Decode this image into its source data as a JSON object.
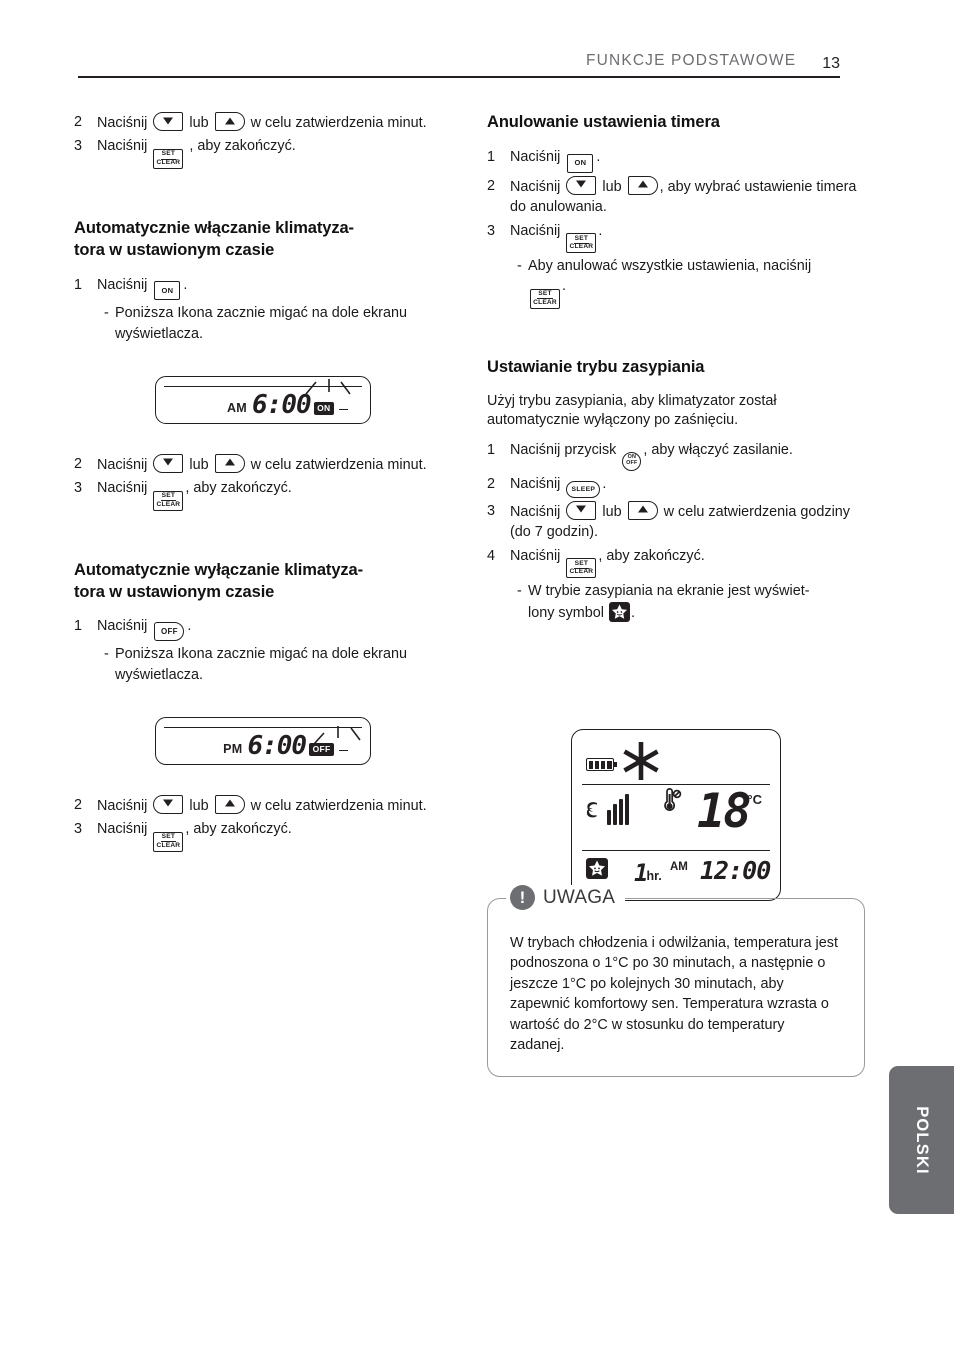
{
  "header": {
    "title": "FUNKCJE PODSTAWOWE",
    "page_number": "13"
  },
  "left_column": {
    "continued_steps": [
      {
        "num": "2",
        "text_before": "Naciśnij",
        "button": "down-up",
        "text_after": "w celu zatwierdzenia minut."
      },
      {
        "num": "3",
        "text_before": "Naciśnij",
        "button": "set-clear",
        "text_after": ", aby zakończyć."
      }
    ],
    "section_auto_on": {
      "heading": "Automatycznie włączanie klimatyza-\ntora w ustawionym czasie",
      "step1_num": "1",
      "step1_before": "Naciśnij",
      "step1_after": ".",
      "step1_button": "ON",
      "note_dash": "-",
      "note_text": "Poniższa Ikona zacznie migać na dole ekranu wyświetlacza.",
      "lcd": {
        "ampm": "AM",
        "time": "6:00",
        "badge": "ON"
      },
      "step2_num": "2",
      "step2_before": "Naciśnij",
      "step2_mid": "lub",
      "step2_after": "w celu zatwierdzenia minut.",
      "step3_num": "3",
      "step3_before": "Naciśnij",
      "step3_after": ", aby zakończyć."
    },
    "section_auto_off": {
      "heading": "Automatycznie wyłączanie klimatyza-\ntora w ustawionym czasie",
      "step1_num": "1",
      "step1_before": "Naciśnij",
      "step1_after": ".",
      "step1_button": "OFF",
      "note_dash": "-",
      "note_text": "Poniższa Ikona zacznie migać na dole ekranu wyświetlacza.",
      "lcd": {
        "ampm": "PM",
        "time": "6:00",
        "badge": "OFF"
      },
      "step2_num": "2",
      "step2_before": "Naciśnij",
      "step2_mid": "lub",
      "step2_after": "w celu zatwierdzenia minut.",
      "step3_num": "3",
      "step3_before": "Naciśnij",
      "step3_after": ", aby zakończyć."
    }
  },
  "right_column": {
    "section_cancel": {
      "heading": "Anulowanie ustawienia timera",
      "step1_num": "1",
      "step1_before": "Naciśnij",
      "step1_after": ".",
      "step1_button": "ON",
      "step2_num": "2",
      "step2_before": "Naciśnij",
      "step2_mid": "lub",
      "step2_after": ", aby wybrać ustawienie timera do anulowania.",
      "step3_num": "3",
      "step3_before": "Naciśnij",
      "step3_after": ".",
      "note_dash": "-",
      "note_text": "Aby anulować wszystkie ustawienia, naciśnij",
      "note_after": "."
    },
    "section_sleep": {
      "heading": "Ustawianie trybu zasypiania",
      "intro": "Użyj trybu zasypiania, aby klimatyzator został automatycznie wyłączony po zaśnięciu.",
      "step1_num": "1",
      "step1_before": "Naciśnij przycisk",
      "step1_after": ", aby włączyć zasilanie.",
      "step2_num": "2",
      "step2_before": "Naciśnij",
      "step2_button": "SLEEP",
      "step2_after": ".",
      "step3_num": "3",
      "step3_before": "Naciśnij",
      "step3_mid": "lub",
      "step3_after": "w celu zatwierdzenia godziny (do 7 godzin).",
      "step4_num": "4",
      "step4_before": "Naciśnij",
      "step4_after": ", aby zakończyć.",
      "note_dash": "-",
      "note_text_1": "W trybie zasypiania na ekranie jest wyświet-",
      "note_text_2": "lony symbol",
      "note_after": "."
    },
    "display": {
      "battery_bars": "4",
      "mode_icon": "snowflake",
      "fan_bars": "4",
      "temperature": "18",
      "unit": "°C",
      "sleep_icon": "sleep-star",
      "hours_value": "1",
      "hours_unit": "hr.",
      "ampm": "AM",
      "time": "12:00"
    },
    "note_box": {
      "title": "UWAGA",
      "icon": "exclamation-icon",
      "body": "W trybach chłodzenia i odwilżania, temperatura jest podnoszona o 1°C po 30 minutach, a następnie o jeszcze 1°C po kolejnych 30 minutach, aby zapewnić komfortowy sen. Temperatura wzrasta o wartość do 2°C w stosunku do temperatury zadanej."
    }
  },
  "side_tab": {
    "label": "POLSKI"
  }
}
